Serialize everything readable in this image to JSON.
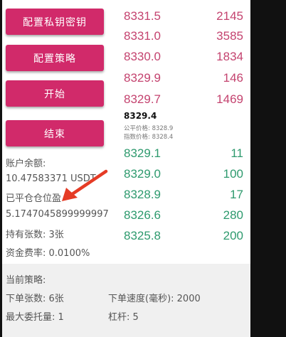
{
  "buttons": {
    "config_keys": "配置私钥密钥",
    "config_strategy": "配置策略",
    "start": "开始",
    "stop": "结束"
  },
  "account": {
    "balance_label": "账户余额:",
    "balance_value": "10.47583371 USDT",
    "closed_label": "已平仓仓位盈",
    "closed_value": "5.1747045899999997",
    "holding": "持有张数: 3张",
    "funding": "资金费率: 0.0100%"
  },
  "asks": [
    {
      "price": "8331.5",
      "qty": "2145"
    },
    {
      "price": "8331.0",
      "qty": "3585"
    },
    {
      "price": "8330.0",
      "qty": "1834"
    },
    {
      "price": "8329.9",
      "qty": "146"
    },
    {
      "price": "8329.7",
      "qty": "1469"
    }
  ],
  "mid": {
    "price": "8329.4",
    "fair": "公平价格:  8328.9",
    "index": "指数价格:  8328.4"
  },
  "bids": [
    {
      "price": "8329.1",
      "qty": "11"
    },
    {
      "price": "8329.0",
      "qty": "100"
    },
    {
      "price": "8328.9",
      "qty": "17"
    },
    {
      "price": "8326.6",
      "qty": "280"
    },
    {
      "price": "8325.8",
      "qty": "200"
    }
  ],
  "strategy": {
    "title": "当前策略:",
    "order_qty": "下单张数: 6张",
    "order_speed": "下单速度(毫秒): 2000",
    "max_orders": "最大委托量: 1",
    "leverage": "杠杆: 5"
  },
  "colors": {
    "button": "#d12a6a",
    "ask": "#c4436f",
    "bid": "#2e9a6e",
    "arrow": "#e53b25"
  }
}
